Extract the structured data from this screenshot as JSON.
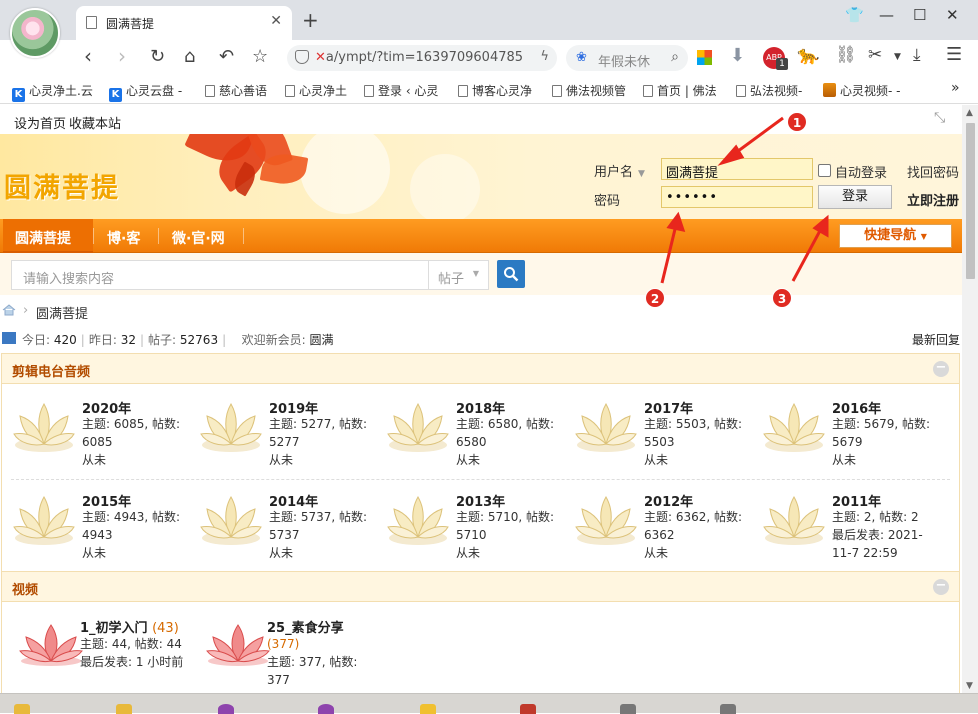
{
  "browser": {
    "tab_title": "圆满菩提",
    "tab_close": "✕",
    "new_tab": "+",
    "url_before": "",
    "url_after": "a/ympt/?tim=1639709604785",
    "search_placeholder": "年假未休",
    "ext_badge_count": "1"
  },
  "bookmarks": [
    {
      "label": "心灵净土.云",
      "icon": "k-icon"
    },
    {
      "label": "心灵云盘 -",
      "icon": "k-icon"
    },
    {
      "label": "慈心善语",
      "icon": "page-icon"
    },
    {
      "label": "心灵净土",
      "icon": "page-icon"
    },
    {
      "label": "登录 ‹ 心灵",
      "icon": "page-icon"
    },
    {
      "label": "博客心灵净",
      "icon": "page-icon"
    },
    {
      "label": "佛法视频管",
      "icon": "page-icon"
    },
    {
      "label": "首页 | 佛法",
      "icon": "page-icon"
    },
    {
      "label": "弘法视频-",
      "icon": "page-icon"
    },
    {
      "label": "心灵视频- -",
      "icon": "image-icon"
    }
  ],
  "bookmarks_more": "»",
  "topbar": {
    "set_home": "设为首页",
    "bookmark_site": "收藏本站"
  },
  "header": {
    "logo": "圆满菩提",
    "username_label": "用户名",
    "username_value": "圆满菩提",
    "password_label": "密码",
    "password_value": "••••••",
    "auto_login": "自动登录",
    "find_password": "找回密码",
    "login_button": "登录",
    "register": "立即注册"
  },
  "nav": {
    "items": [
      "圆满菩提",
      "博·客",
      "微·官·网"
    ],
    "quick_nav": "快捷导航"
  },
  "search": {
    "placeholder": "请输入搜索内容",
    "type": "帖子"
  },
  "breadcrumb": {
    "current": "圆满菩提"
  },
  "stats": {
    "today_label": "今日:",
    "today": "420",
    "yesterday_label": "昨日:",
    "yesterday": "32",
    "posts_label": "帖子:",
    "posts": "52763",
    "welcome_label": "欢迎新会员:",
    "new_member": "圆满",
    "latest_reply": "最新回复"
  },
  "sections": [
    {
      "title": "剪辑电台音频",
      "forums": [
        {
          "name": "2020年",
          "meta": "主题: 6085, 帖数: 6085",
          "last": "从未"
        },
        {
          "name": "2019年",
          "meta": "主题: 5277, 帖数: 5277",
          "last": "从未"
        },
        {
          "name": "2018年",
          "meta": "主题: 6580, 帖数: 6580",
          "last": "从未"
        },
        {
          "name": "2017年",
          "meta": "主题: 5503, 帖数: 5503",
          "last": "从未"
        },
        {
          "name": "2016年",
          "meta": "主题: 5679, 帖数: 5679",
          "last": "从未"
        },
        {
          "name": "2015年",
          "meta": "主题: 4943, 帖数: 4943",
          "last": "从未"
        },
        {
          "name": "2014年",
          "meta": "主题: 5737, 帖数: 5737",
          "last": "从未"
        },
        {
          "name": "2013年",
          "meta": "主题: 5710, 帖数: 5710",
          "last": "从未"
        },
        {
          "name": "2012年",
          "meta": "主题: 6362, 帖数: 6362",
          "last": "从未"
        },
        {
          "name": "2011年",
          "meta": "主题: 2, 帖数: 2",
          "last": "最后发表: 2021-11-7 22:59"
        }
      ]
    },
    {
      "title": "视频",
      "forums": [
        {
          "name": "1_初学入门",
          "count": "(43)",
          "meta": "主题: 44, 帖数: 44",
          "last": "最后发表: 1 小时前"
        },
        {
          "name": "25_素食分享",
          "count": "(377)",
          "meta": "主题: 377, 帖数: 377",
          "last": ""
        }
      ]
    }
  ],
  "annotations": [
    "1",
    "2",
    "3"
  ],
  "colors": {
    "nav_orange": "#f07a06",
    "section_title": "#b24c00",
    "search_blue": "#2b7ac3",
    "annotation_red": "#e02b22"
  }
}
